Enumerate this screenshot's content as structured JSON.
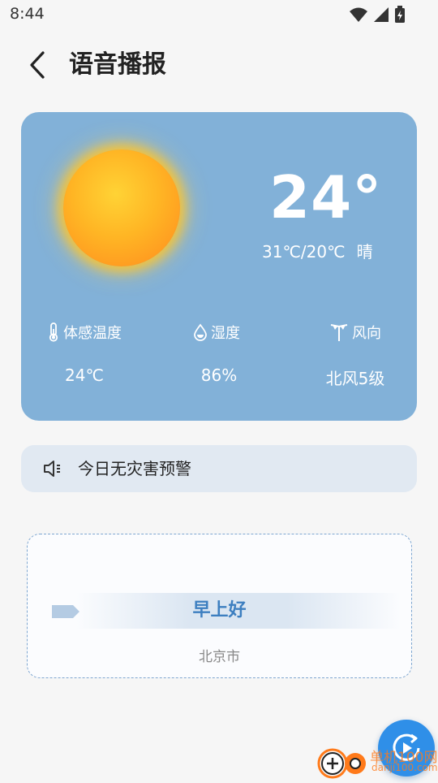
{
  "status_bar": {
    "time": "8:44"
  },
  "nav": {
    "title": "语音播报"
  },
  "weather": {
    "current_temp": "24°",
    "range": "31℃/20℃",
    "condition": "晴",
    "metrics": [
      {
        "label": "体感温度",
        "value": "24℃",
        "icon": "thermometer-icon"
      },
      {
        "label": "湿度",
        "value": "86%",
        "icon": "water-drop-icon"
      },
      {
        "label": "风向",
        "value": "北风5级",
        "icon": "wind-icon"
      }
    ]
  },
  "alert": {
    "text": "今日无灾害预警",
    "icon": "speaker-icon"
  },
  "greeting": {
    "text": "早上好",
    "city": "北京市"
  },
  "watermark": {
    "text": "单机100网",
    "url": "danji100.com"
  },
  "colors": {
    "card": "#82b1d8",
    "accent": "#3d7fc0",
    "fab": "#2f8fe8",
    "alert_bg": "#e1e9f2"
  }
}
